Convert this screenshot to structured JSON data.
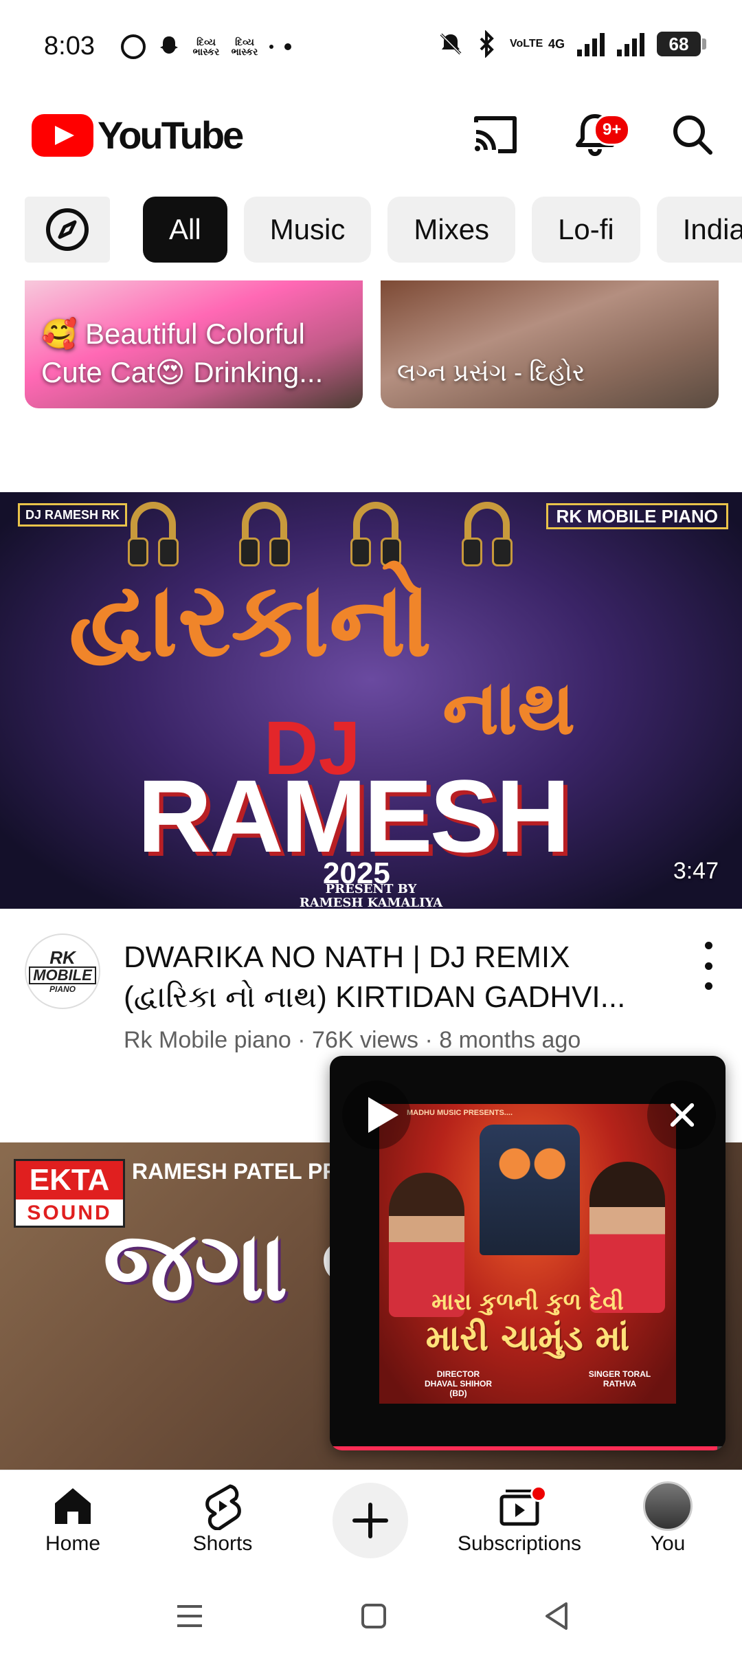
{
  "status_bar": {
    "time": "8:03",
    "left_icon_text_1": "દિવ્ય ભાસ્કર",
    "left_icon_text_2": "દિવ્ય ભાસ્કર",
    "network_label": "VoLTE",
    "signal_label": "4G",
    "battery": "68"
  },
  "header": {
    "logo_text": "YouTube",
    "notification_badge": "9+",
    "icons": [
      "cast-icon",
      "bell-icon",
      "search-icon"
    ]
  },
  "chips": {
    "explore_icon": "compass-icon",
    "items": [
      "All",
      "Music",
      "Mixes",
      "Lo-fi",
      "India"
    ],
    "active": "All"
  },
  "top_cards": [
    {
      "label": "🥰 Beautiful Colorful Cute Cat😍 Drinking..."
    },
    {
      "label": "લગ્ન પ્રસંગ - દિહોર"
    }
  ],
  "video_1": {
    "thumbnail": {
      "corner_left": "DJ RAMESH RK",
      "corner_right": "RK MOBILE PIANO",
      "gujarati_title": "દ્વારકાનો",
      "gujarati_subtitle": "નાથ",
      "dj_tag": "DJ",
      "dj_name": "RAMESH",
      "year": "2025",
      "present_line_1": "PRESENT BY",
      "present_line_2": "RAMESH KAMALIYA"
    },
    "duration": "3:47",
    "title": "DWARIKA NO NATH | DJ REMIX (દ્વારિકા નો નાથ) KIRTIDAN GADHVI...",
    "channel": "Rk Mobile piano",
    "views": "76K views",
    "age": "8 months ago",
    "avatar_text_1": "RK",
    "avatar_text_2": "MOBILE",
    "avatar_text_3": "PIANO"
  },
  "video_2": {
    "thumbnail": {
      "brand_top": "EKTA",
      "brand_bottom": "SOUND",
      "presenter": "RAMESH PATEL PRESE",
      "gujarati_title": "જગા જુઠી"
    }
  },
  "mini_player": {
    "line_1": "મારા કુળની કુળ દેવી",
    "line_2": "મારી ચામુંડ માં",
    "credit_top": "MADHU MUSIC PRESENTS....",
    "credit_director": "DIRECTOR DHAVAL SHIHOR (BD)",
    "credit_singer": "SINGER TORAL RATHVA",
    "progress": 0.98
  },
  "bottom_nav": {
    "items": [
      {
        "label": "Home",
        "icon": "home-icon"
      },
      {
        "label": "Shorts",
        "icon": "shorts-icon"
      },
      {
        "label": "",
        "icon": "create-plus-icon"
      },
      {
        "label": "Subscriptions",
        "icon": "subscriptions-icon"
      },
      {
        "label": "You",
        "icon": "avatar-icon"
      }
    ]
  },
  "colors": {
    "brand_red": "#ff0000",
    "chip_active": "#0f0f0f",
    "chip_bg": "#f0f0f0",
    "meta_gray": "#606060",
    "progress_pink": "#ff2d55"
  }
}
